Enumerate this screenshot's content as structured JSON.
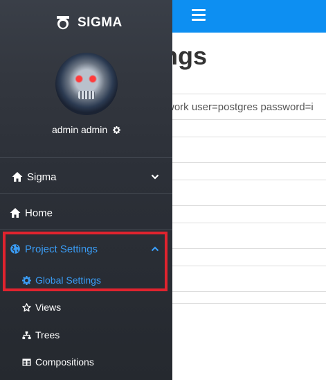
{
  "colors": {
    "accent": "#0d8ff2",
    "active_link": "#3a9cf5",
    "highlight_border": "#e0232e",
    "sidebar_bg": "#2c3038"
  },
  "sidebar": {
    "brand": {
      "text": "SIGMA",
      "icon": "sigma-logo-icon"
    },
    "user": {
      "name": "admin admin",
      "icon": "gear-icon"
    },
    "nav": {
      "sigma": {
        "label": "Sigma",
        "icon": "home-icon",
        "chevron": "chevron-down-icon"
      },
      "home": {
        "label": "Home",
        "icon": "home-icon"
      },
      "project_settings": {
        "label": "Project Settings",
        "icon": "globe-icon",
        "chevron": "chevron-up-icon",
        "expanded": true
      },
      "global_settings": {
        "label": "Global Settings",
        "icon": "gear-icon",
        "active": true
      },
      "views": {
        "label": "Views",
        "icon": "star-icon"
      },
      "trees": {
        "label": "Trees",
        "icon": "sitemap-icon"
      },
      "compositions": {
        "label": "Compositions",
        "icon": "table-icon"
      }
    }
  },
  "main": {
    "menu_icon": "hamburger-icon",
    "title_visible": "ngs",
    "connection_text_visible": "work user=postgres password=i"
  }
}
